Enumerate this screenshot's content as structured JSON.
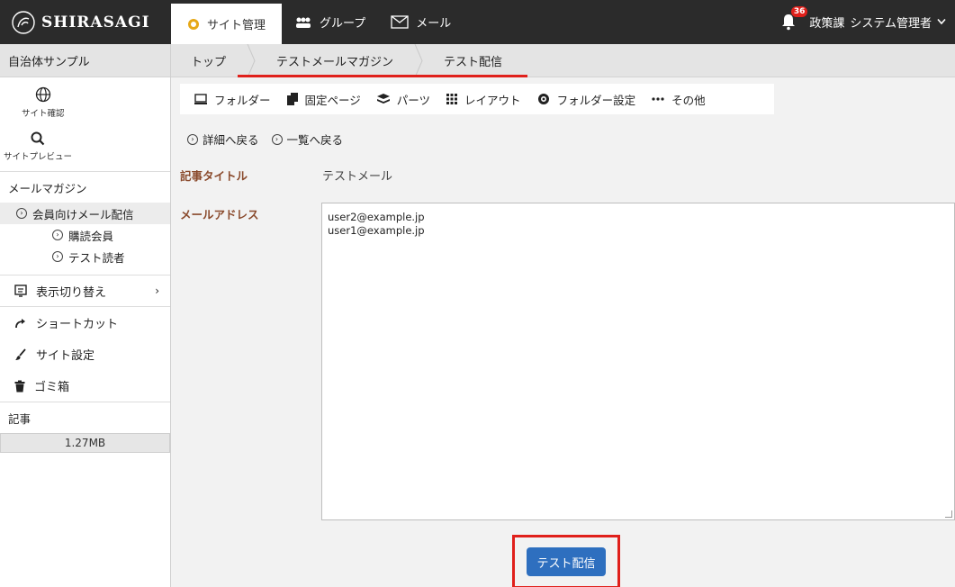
{
  "header": {
    "logo": "SHIRASAGI",
    "nav": [
      {
        "label": "サイト管理",
        "icon": "gear-icon"
      },
      {
        "label": "グループ",
        "icon": "group-icon"
      },
      {
        "label": "メール",
        "icon": "mail-icon"
      }
    ],
    "notifications_count": "36",
    "user_group": "政策課",
    "user_name": "システム管理者"
  },
  "sidebar": {
    "site_name": "自治体サンプル",
    "tools": [
      {
        "label": "サイト確認",
        "icon": "globe-icon"
      },
      {
        "label": "サイトプレビュー",
        "icon": "search-icon"
      }
    ],
    "mail_section": "メールマガジン",
    "tree": [
      {
        "label": "会員向けメール配信",
        "level": 1
      },
      {
        "label": "購読会員",
        "level": 2
      },
      {
        "label": "テスト読者",
        "level": 2
      }
    ],
    "menu": [
      {
        "label": "表示切り替え",
        "icon": "display-icon"
      },
      {
        "label": "ショートカット",
        "icon": "shortcut-icon"
      },
      {
        "label": "サイト設定",
        "icon": "settings-brush-icon"
      },
      {
        "label": "ゴミ箱",
        "icon": "trash-icon"
      }
    ],
    "article_section": "記事",
    "usage": "1.27MB"
  },
  "breadcrumb": [
    "トップ",
    "テストメールマガジン",
    "テスト配信"
  ],
  "toolbar": [
    {
      "label": "フォルダー",
      "icon": "folder-icon"
    },
    {
      "label": "固定ページ",
      "icon": "page-icon"
    },
    {
      "label": "パーツ",
      "icon": "parts-icon"
    },
    {
      "label": "レイアウト",
      "icon": "layout-icon"
    },
    {
      "label": "フォルダー設定",
      "icon": "folder-settings-icon"
    },
    {
      "label": "その他",
      "icon": "more-icon"
    }
  ],
  "backlinks": [
    "詳細へ戻る",
    "一覧へ戻る"
  ],
  "form": {
    "title_label": "記事タイトル",
    "title_value": "テストメール",
    "address_label": "メールアドレス",
    "addresses": [
      "user2@example.jp",
      "user1@example.jp"
    ]
  },
  "submit_label": "テスト配信",
  "colors": {
    "topbar": "#2b2b2b",
    "accent_red": "#e0201b",
    "button_blue": "#2e6fbf",
    "label_brown": "#8a4a2c"
  }
}
